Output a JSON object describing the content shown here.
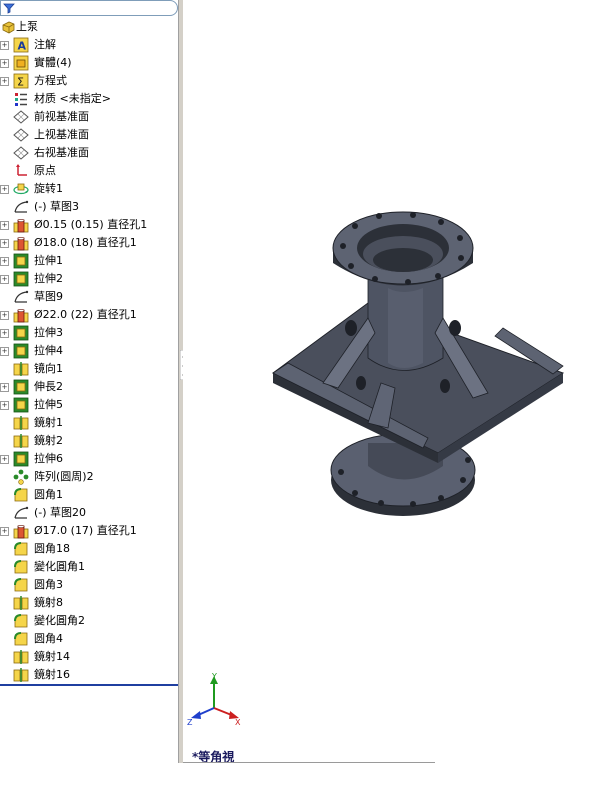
{
  "root": {
    "label": "上泵",
    "icon": "part-icon"
  },
  "tree_items": [
    {
      "label": "注解",
      "icon": "annotation-icon",
      "expandable": true
    },
    {
      "label": "實體(4)",
      "icon": "solid-bodies-icon",
      "expandable": true
    },
    {
      "label": "方程式",
      "icon": "equations-icon",
      "expandable": true
    },
    {
      "label": "材质 <未指定>",
      "icon": "material-icon",
      "expandable": false
    },
    {
      "label": "前视基准面",
      "icon": "plane-icon",
      "expandable": false
    },
    {
      "label": "上视基准面",
      "icon": "plane-icon",
      "expandable": false
    },
    {
      "label": "右视基准面",
      "icon": "plane-icon",
      "expandable": false
    },
    {
      "label": "原点",
      "icon": "origin-icon",
      "expandable": false
    },
    {
      "label": "旋转1",
      "icon": "revolve-icon",
      "expandable": true
    },
    {
      "label": "(-) 草图3",
      "icon": "sketch-icon",
      "expandable": false
    },
    {
      "label": "Ø0.15 (0.15) 直径孔1",
      "icon": "hole-icon",
      "expandable": true
    },
    {
      "label": "Ø18.0 (18) 直径孔1",
      "icon": "hole-icon",
      "expandable": true
    },
    {
      "label": "拉伸1",
      "icon": "extrude-icon",
      "expandable": true
    },
    {
      "label": "拉伸2",
      "icon": "extrude-icon",
      "expandable": true
    },
    {
      "label": "草图9",
      "icon": "sketch-icon",
      "expandable": false
    },
    {
      "label": "Ø22.0 (22) 直径孔1",
      "icon": "hole-icon",
      "expandable": true
    },
    {
      "label": "拉伸3",
      "icon": "extrude-icon",
      "expandable": true
    },
    {
      "label": "拉伸4",
      "icon": "extrude-icon",
      "expandable": true
    },
    {
      "label": "镜向1",
      "icon": "mirror-icon",
      "expandable": false
    },
    {
      "label": "伸長2",
      "icon": "extrude-icon",
      "expandable": true
    },
    {
      "label": "拉伸5",
      "icon": "extrude-icon",
      "expandable": true
    },
    {
      "label": "鏡射1",
      "icon": "mirror-icon",
      "expandable": false
    },
    {
      "label": "鏡射2",
      "icon": "mirror-icon",
      "expandable": false
    },
    {
      "label": "拉伸6",
      "icon": "extrude-icon",
      "expandable": true
    },
    {
      "label": "阵列(圆周)2",
      "icon": "circular-pattern-icon",
      "expandable": false
    },
    {
      "label": "圆角1",
      "icon": "fillet-icon",
      "expandable": false
    },
    {
      "label": "(-) 草图20",
      "icon": "sketch-icon",
      "expandable": false
    },
    {
      "label": "Ø17.0 (17) 直径孔1",
      "icon": "hole-icon",
      "expandable": true
    },
    {
      "label": "圆角18",
      "icon": "fillet-icon",
      "expandable": false
    },
    {
      "label": "變化圓角1",
      "icon": "fillet-icon",
      "expandable": false
    },
    {
      "label": "圆角3",
      "icon": "fillet-icon",
      "expandable": false
    },
    {
      "label": "鏡射8",
      "icon": "mirror-icon",
      "expandable": false
    },
    {
      "label": "變化圓角2",
      "icon": "fillet-icon",
      "expandable": false
    },
    {
      "label": "圆角4",
      "icon": "fillet-icon",
      "expandable": false
    },
    {
      "label": "鏡射14",
      "icon": "mirror-icon",
      "expandable": false
    },
    {
      "label": "鏡射16",
      "icon": "mirror-icon",
      "expandable": false
    }
  ],
  "triad": {
    "x": "X",
    "y": "Y",
    "z": "Z"
  },
  "viewport": {
    "view_name": "*等角視"
  },
  "colors": {
    "selection_border": "#1f3fa0",
    "model_body": "#4a4f5c",
    "model_light": "#6c7282",
    "model_dark": "#2c3038",
    "axis_x": "#cc1f1f",
    "axis_y": "#1f9a1f",
    "axis_z": "#1f3fcc"
  }
}
